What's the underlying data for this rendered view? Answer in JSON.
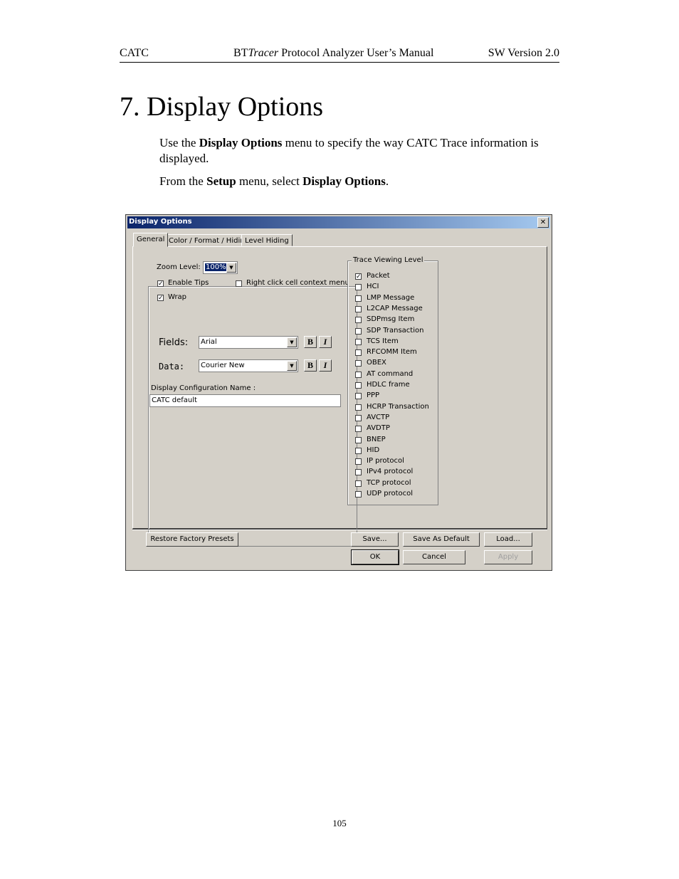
{
  "header": {
    "left": "CATC",
    "center_prefix": "BT",
    "center_italic": "Tracer",
    "center_suffix": " Protocol Analyzer User’s Manual",
    "right": "SW Version 2.0"
  },
  "section_title": "7.  Display Options",
  "intro": {
    "p1_a": "Use the ",
    "p1_b": "Display Options",
    "p1_c": " menu to specify the way CATC Trace information is displayed.",
    "p2_a": "From the ",
    "p2_b": "Setup",
    "p2_c": " menu, select ",
    "p2_d": "Display Options",
    "p2_e": "."
  },
  "dialog": {
    "title": "Display Options",
    "close": "✕",
    "tabs": [
      "General",
      "Color / Format / Hiding",
      "Level Hiding"
    ],
    "zoom_label": "Zoom Level:",
    "zoom_value": "100%",
    "enable_tips": {
      "label": "Enable Tips",
      "checked": true
    },
    "right_click": {
      "label": "Right click cell context menu",
      "checked": false
    },
    "wrap": {
      "label": "Wrap",
      "checked": true
    },
    "fields_label": "Fields:",
    "fields_font": "Arial",
    "data_label": "Data:",
    "data_font": "Courier New",
    "bold_btn": "B",
    "italic_btn": "I",
    "config_label": "Display Configuration Name :",
    "config_value": "CATC default",
    "trace_group": "Trace Viewing Level",
    "levels": [
      {
        "label": "Packet",
        "checked": true
      },
      {
        "label": "HCI",
        "checked": false
      },
      {
        "label": "LMP Message",
        "checked": false
      },
      {
        "label": "L2CAP Message",
        "checked": false
      },
      {
        "label": "SDPmsg Item",
        "checked": false
      },
      {
        "label": "SDP Transaction",
        "checked": false
      },
      {
        "label": "TCS Item",
        "checked": false
      },
      {
        "label": "RFCOMM Item",
        "checked": false
      },
      {
        "label": "OBEX",
        "checked": false
      },
      {
        "label": "AT command",
        "checked": false
      },
      {
        "label": "HDLC frame",
        "checked": false
      },
      {
        "label": "PPP",
        "checked": false
      },
      {
        "label": "HCRP Transaction",
        "checked": false
      },
      {
        "label": "AVCTP",
        "checked": false
      },
      {
        "label": "AVDTP",
        "checked": false
      },
      {
        "label": "BNEP",
        "checked": false
      },
      {
        "label": "HID",
        "checked": false
      },
      {
        "label": "IP protocol",
        "checked": false
      },
      {
        "label": "IPv4 protocol",
        "checked": false
      },
      {
        "label": "TCP protocol",
        "checked": false
      },
      {
        "label": "UDP protocol",
        "checked": false
      }
    ],
    "buttons": {
      "restore": "Restore Factory Presets",
      "save": "Save...",
      "save_default": "Save As Default",
      "load": "Load...",
      "ok": "OK",
      "cancel": "Cancel",
      "apply": "Apply"
    }
  },
  "page_number": "105"
}
